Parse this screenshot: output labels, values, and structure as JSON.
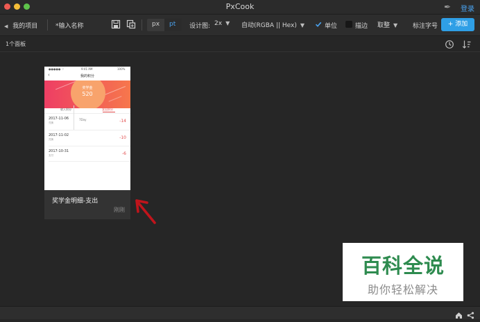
{
  "window": {
    "title": "PxCook",
    "login": "登录"
  },
  "toolbar": {
    "back_label": "我的项目",
    "name_placeholder": "*输入名称",
    "unit_px": "px",
    "unit_pt": "pt",
    "design_label": "设计图:",
    "design_value": "2x",
    "color_format": "自动(RGBA || Hex)",
    "unit_checkbox": "单位",
    "unit_checked": true,
    "stroke_checkbox": "描边",
    "stroke_checked": false,
    "rounding": "取整",
    "annotate_font": "标注字号",
    "add_button": "+ 添加"
  },
  "subbar": {
    "panel_count": "1个面板"
  },
  "card": {
    "name": "奖学金明细-支出",
    "time": "刚刚",
    "thumb": {
      "status_time": "9:41 AM",
      "status_battery": "100%",
      "nav_title": "我的积分",
      "banner_label": "奖学金",
      "banner_value": "520",
      "tabs": [
        "收入积分",
        "支出积分"
      ],
      "rows": [
        {
          "date": "2017-11-06",
          "desc": "兑换",
          "note": "7Day",
          "amount": "-14"
        },
        {
          "date": "2017-11-02",
          "desc": "兑换",
          "amount": "-10"
        },
        {
          "date": "2017-10-31",
          "desc": "支付",
          "amount": "-6"
        }
      ]
    }
  },
  "watermark": {
    "line1": "百科全说",
    "line2": "助你轻松解决"
  },
  "colors": {
    "accent": "#2f9fe6",
    "background": "#262626",
    "banner": "#ef4a6a"
  }
}
